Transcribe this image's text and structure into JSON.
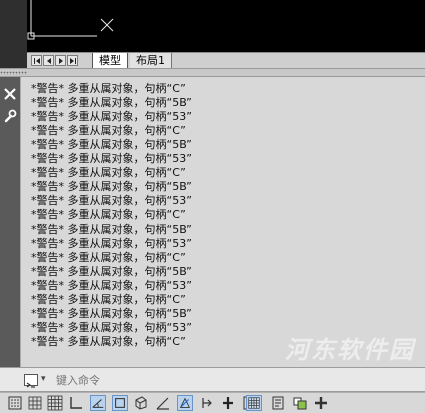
{
  "layout_tabs": [
    {
      "label": "模型",
      "active": true
    },
    {
      "label": "布局1",
      "active": false
    }
  ],
  "command_history": [
    "*警告* 多重从属对象，句柄“C”",
    "*警告* 多重从属对象，句柄“5B”",
    "*警告* 多重从属对象，句柄“53”",
    "*警告* 多重从属对象，句柄“C”",
    "*警告* 多重从属对象，句柄“5B”",
    "*警告* 多重从属对象，句柄“53”",
    "*警告* 多重从属对象，句柄“C”",
    "*警告* 多重从属对象，句柄“5B”",
    "*警告* 多重从属对象，句柄“53”",
    "*警告* 多重从属对象，句柄“C”",
    "*警告* 多重从属对象，句柄“5B”",
    "*警告* 多重从属对象，句柄“53”",
    "*警告* 多重从属对象，句柄“C”",
    "*警告* 多重从属对象，句柄“5B”",
    "*警告* 多重从属对象，句柄“53”",
    "*警告* 多重从属对象，句柄“C”",
    "*警告* 多重从属对象，句柄“5B”",
    "*警告* 多重从属对象，句柄“53”",
    "*警告* 多重从属对象，句柄“C”"
  ],
  "command_input": {
    "placeholder": "键入命令"
  },
  "watermark": "河东软件园",
  "icons": {
    "close": "close-icon",
    "customize": "wrench-icon",
    "nav": [
      "first-icon",
      "prev-icon",
      "next-icon",
      "last-icon"
    ],
    "status": [
      "grid-snap-icon",
      "grid-display-icon",
      "ortho-icon",
      "polar-icon",
      "osnap-icon",
      "3d-osnap-icon",
      "otrack-icon",
      "ducs-icon",
      "dyn-icon",
      "lineweight-icon",
      "transparency-icon",
      "quick-properties-icon",
      "selection-cycling-icon",
      "annotation-monitor-icon"
    ]
  },
  "colors": {
    "canvas": "#000000",
    "accent_on": "#b9d3ee"
  }
}
